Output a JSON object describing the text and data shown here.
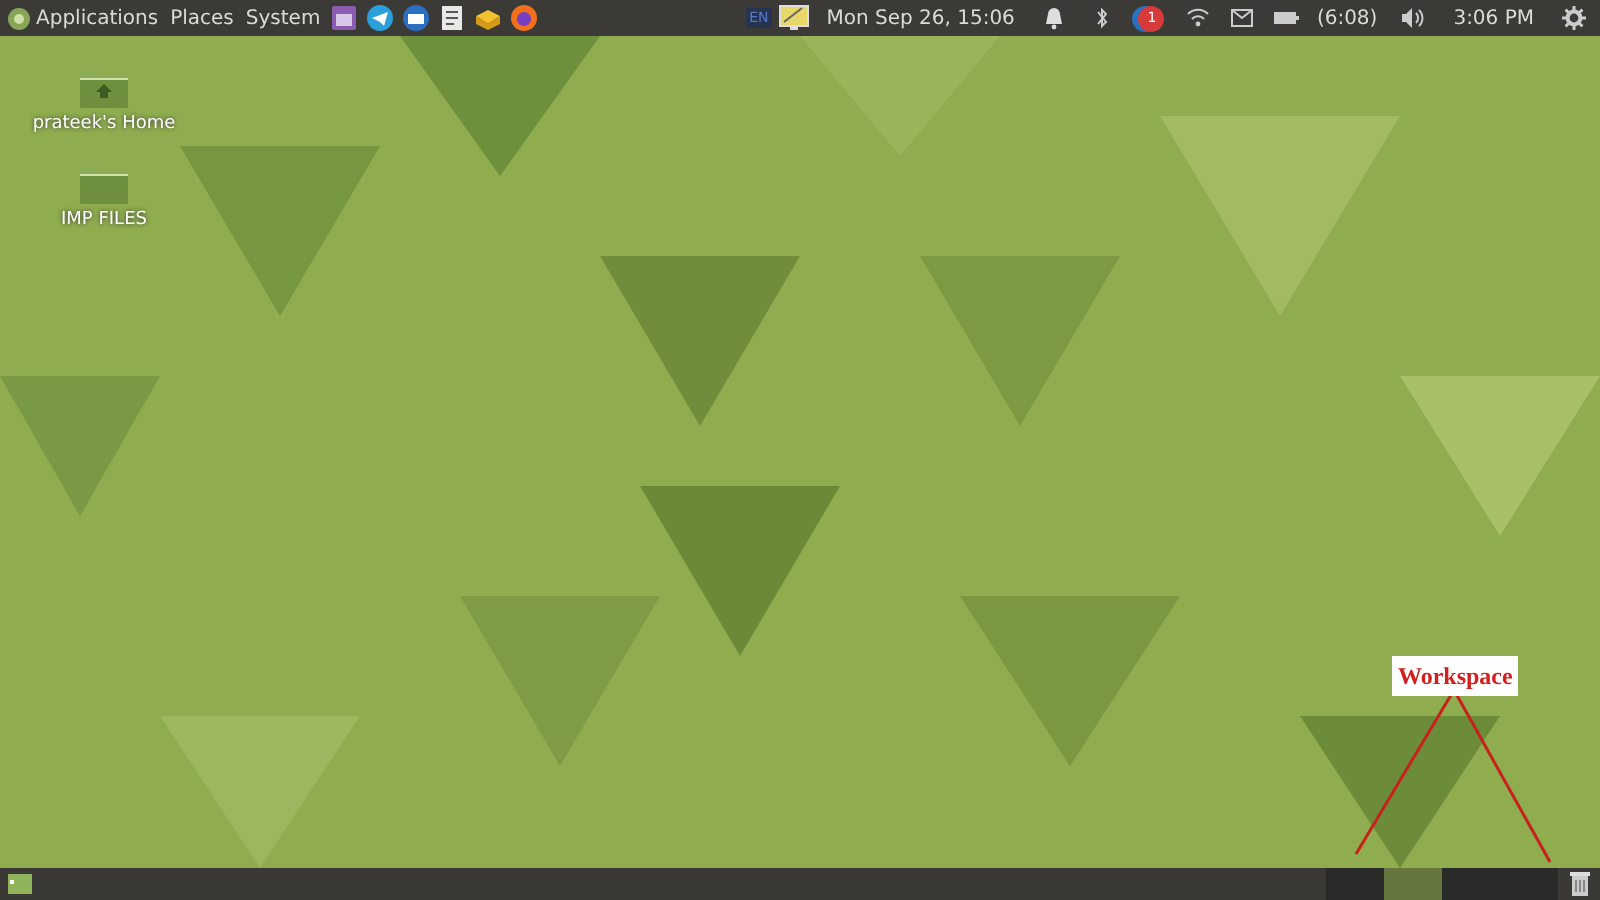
{
  "top_panel": {
    "menus": [
      {
        "label": "Applications"
      },
      {
        "label": "Places"
      },
      {
        "label": "System"
      }
    ],
    "indicators": {
      "keyboard": "EN",
      "datetime": "Mon Sep 26, 15:06",
      "notification_count": "1",
      "battery": "(6:08)",
      "clock": "3:06 PM"
    }
  },
  "desktop_icons": [
    {
      "label": "prateek's Home",
      "kind": "home"
    },
    {
      "label": "IMP FILES",
      "kind": "folder"
    }
  ],
  "annotation": {
    "label": "Workspace"
  },
  "bottom_panel": {
    "workspaces": [
      {
        "selected": false
      },
      {
        "selected": true
      },
      {
        "selected": false
      },
      {
        "selected": false
      }
    ]
  }
}
